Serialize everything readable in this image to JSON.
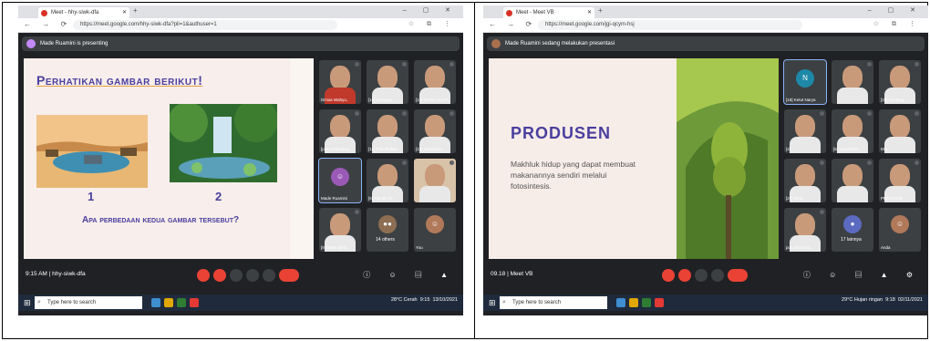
{
  "left": {
    "tab_title": "Meet - hhy-siwk-dfa",
    "url": "https://meet.google.com/hhy-siwk-dfa?pli=1&authuser=1",
    "presenting": "Made Ruamini is presenting",
    "slide": {
      "title": "Perhatikan gambar berikut!",
      "label1": "1",
      "label2": "2",
      "question": "Apa perbedaan kedua gambar tersebut?"
    },
    "participants": [
      "Dimas Wahyu..",
      "[19] Komang ..",
      "[17] PUTU AYU P..",
      "[putu Kharisma..",
      "[11] Putu Rulian..",
      "[15] Kharisma ..",
      "Made Ruamini",
      "[6] Handhi Kr..",
      "",
      "[9] Made Dind..",
      "14 others",
      "You"
    ],
    "meeting_info": "9:15 AM  |  hhy-siwk-dfa",
    "search_placeholder": "Type here to search",
    "tray_text": "28°C Cerah",
    "tray_time": "9:15",
    "tray_date": "13/10/2021"
  },
  "right": {
    "tab_title": "Meet - Meet VB",
    "url": "https://meet.google.com/jgi-qcym-hsj",
    "presenting": "Made Ruamini sedang melakukan presentasi",
    "slide": {
      "title": "PRODUSEN",
      "body": "Makhluk hidup yang dapat membuat makanannya sendiri melalui fotosintesis."
    },
    "participants": [
      "[18] Ketut Narya",
      "",
      "[20] Komang ..",
      "[4] ..",
      "[5] Gana Prat..",
      "Mel..",
      "[27] Rina..",
      "",
      "PRECILINE",
      "putu Ratna D..",
      "17 lainnya",
      "Anda"
    ],
    "meeting_info": "09.18  |  Meet VB",
    "search_placeholder": "Type here to search",
    "tray_text": "29°C Hujan ringan",
    "tray_time": "9:18",
    "tray_date": "02/11/2021"
  }
}
